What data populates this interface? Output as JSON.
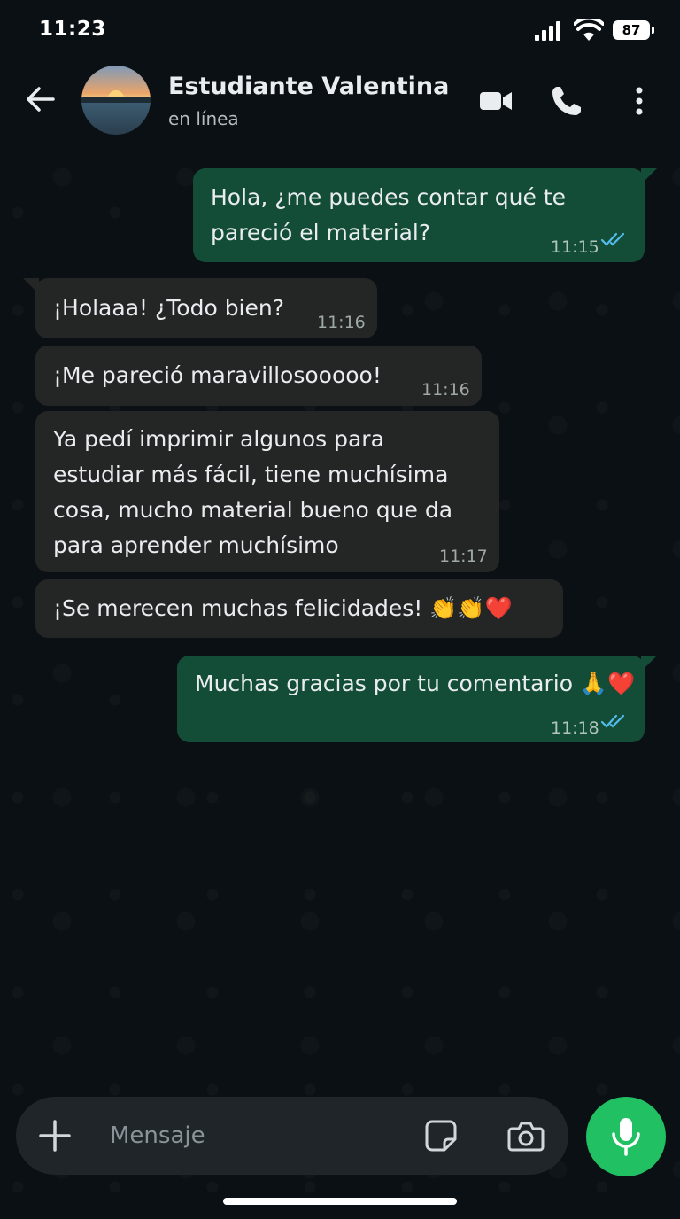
{
  "status_bar": {
    "time": "11:23",
    "battery": "87",
    "icons": [
      "signal-icon",
      "wifi-icon",
      "battery-icon"
    ]
  },
  "header": {
    "contact_name": "Estudiante Valentina",
    "contact_status": "en línea",
    "icons": [
      "back-arrow-icon",
      "video-call-icon",
      "phone-icon",
      "more-options-icon"
    ]
  },
  "messages": [
    {
      "direction": "out",
      "lines": [
        "Hola, ¿me puedes contar qué te",
        "pareció el material?"
      ],
      "time": "11:15",
      "read": true
    },
    {
      "direction": "in",
      "lines": [
        "¡Holaaa! ¿Todo bien?"
      ],
      "time": "11:16"
    },
    {
      "direction": "in",
      "lines": [
        "¡Me pareció maravillosooooo!"
      ],
      "time": "11:16"
    },
    {
      "direction": "in",
      "lines": [
        "Ya pedí imprimir algunos para",
        "estudiar más fácil, tiene muchísima",
        "cosa, mucho material bueno que da",
        "para aprender muchísimo"
      ],
      "time": "11:17"
    },
    {
      "direction": "in",
      "lines": [
        "¡Se merecen muchas felicidades! 👏👏❤️"
      ],
      "time": ""
    },
    {
      "direction": "out",
      "lines": [
        "Muchas gracias por tu comentario 🙏❤️"
      ],
      "time": "11:18",
      "read": true
    }
  ],
  "composer": {
    "placeholder": "Mensaje",
    "icons": [
      "plus-icon",
      "sticker-icon",
      "camera-icon",
      "microphone-icon"
    ]
  },
  "colors": {
    "background": "#0b1014",
    "outgoing_bubble": "#144d37",
    "incoming_bubble": "#242626",
    "accent_green": "#21c063",
    "read_ticks": "#53bdeb"
  }
}
